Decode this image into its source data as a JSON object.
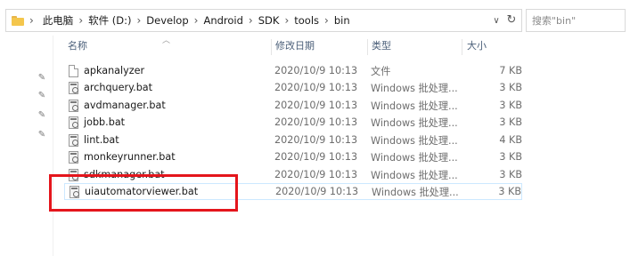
{
  "address_bar": {
    "breadcrumbs": [
      "此电脑",
      "软件 (D:)",
      "Develop",
      "Android",
      "SDK",
      "tools",
      "bin"
    ]
  },
  "search": {
    "placeholder": "搜索\"bin\""
  },
  "columns": {
    "name": "名称",
    "date": "修改日期",
    "type": "类型",
    "size": "大小"
  },
  "files": [
    {
      "name": "apkanalyzer",
      "date": "2020/10/9 10:13",
      "type": "文件",
      "size": "7 KB",
      "icon": "file-icon"
    },
    {
      "name": "archquery.bat",
      "date": "2020/10/9 10:13",
      "type": "Windows 批处理...",
      "size": "3 KB",
      "icon": "bat-file-icon"
    },
    {
      "name": "avdmanager.bat",
      "date": "2020/10/9 10:13",
      "type": "Windows 批处理...",
      "size": "3 KB",
      "icon": "bat-file-icon"
    },
    {
      "name": "jobb.bat",
      "date": "2020/10/9 10:13",
      "type": "Windows 批处理...",
      "size": "3 KB",
      "icon": "bat-file-icon"
    },
    {
      "name": "lint.bat",
      "date": "2020/10/9 10:13",
      "type": "Windows 批处理...",
      "size": "4 KB",
      "icon": "bat-file-icon"
    },
    {
      "name": "monkeyrunner.bat",
      "date": "2020/10/9 10:13",
      "type": "Windows 批处理...",
      "size": "3 KB",
      "icon": "bat-file-icon"
    },
    {
      "name": "sdkmanager.bat",
      "date": "2020/10/9 10:13",
      "type": "Windows 批处理...",
      "size": "3 KB",
      "icon": "bat-file-icon"
    },
    {
      "name": "uiautomatorviewer.bat",
      "date": "2020/10/9 10:13",
      "type": "Windows 批处理...",
      "size": "3 KB",
      "icon": "bat-file-icon"
    }
  ],
  "colors": {
    "annotation": "#e4151c",
    "selection_border": "#cce8ff"
  }
}
